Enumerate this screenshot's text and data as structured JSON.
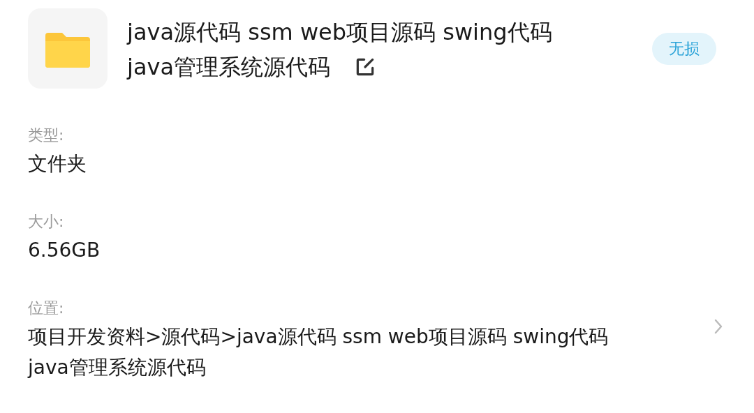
{
  "header": {
    "name_lines": [
      "java源代码 ssm web项目源码 swing代码",
      "java管理系统源代码"
    ],
    "badge": "无损"
  },
  "fields": [
    {
      "kind": "plain",
      "label": "类型:",
      "value_lines": [
        "文件夹"
      ]
    },
    {
      "kind": "plain",
      "label": "大小:",
      "value_lines": [
        "6.56GB"
      ]
    },
    {
      "kind": "link",
      "label": "位置:",
      "value_lines": [
        "项目开发资料>源代码>java源代码 ssm web项目源码 swing代码",
        "java管理系统源代码"
      ]
    }
  ]
}
